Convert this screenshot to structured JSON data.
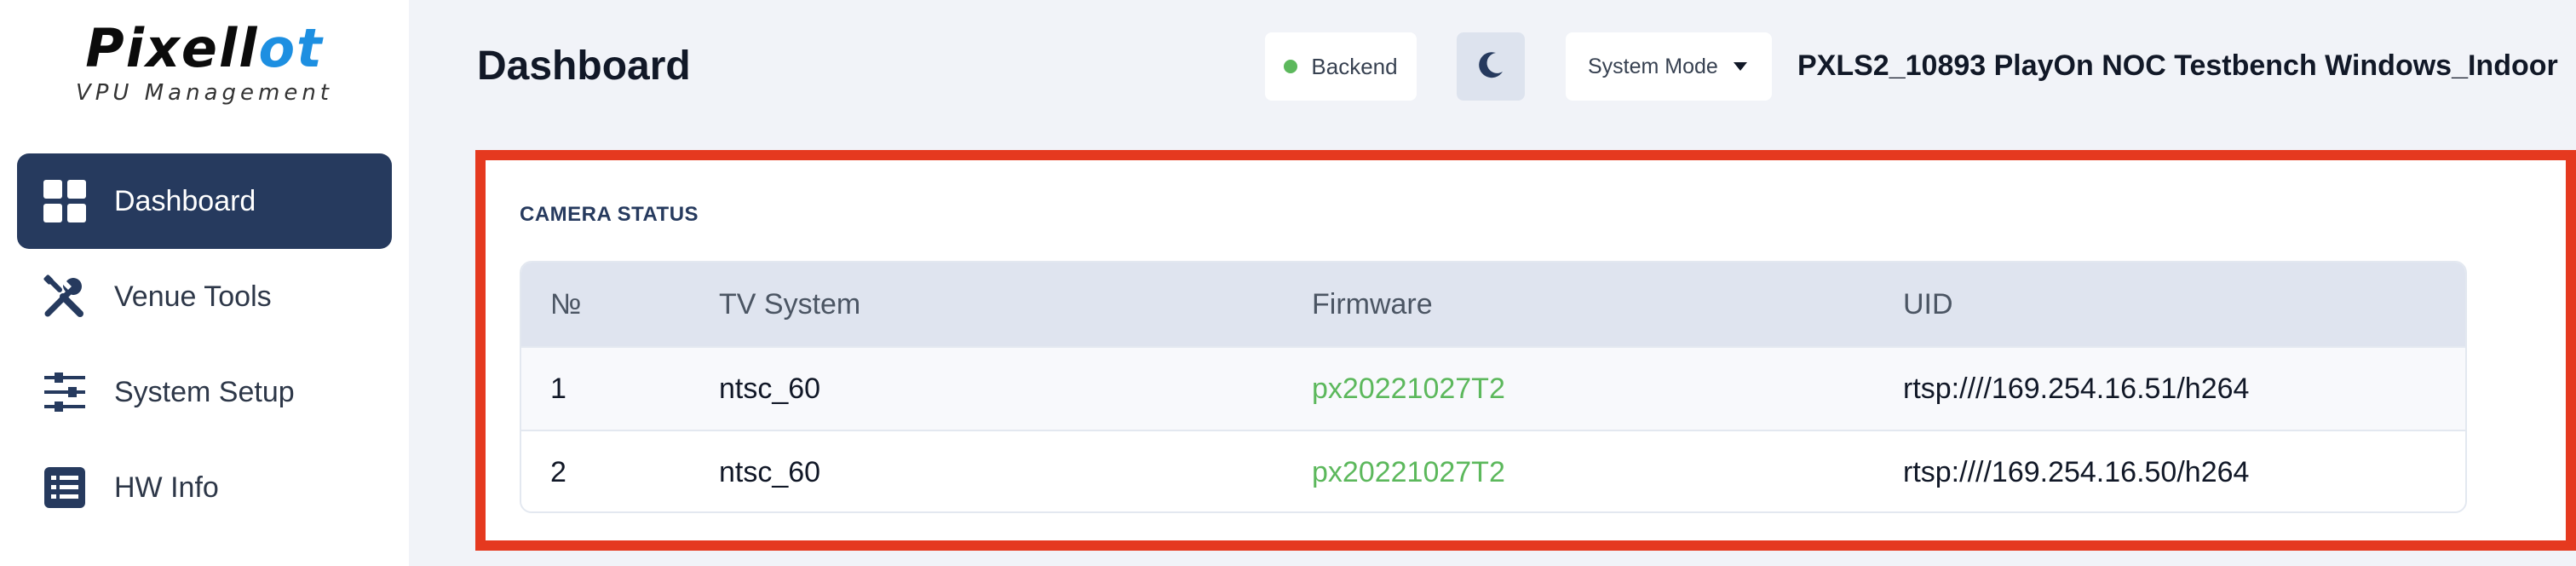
{
  "sidebar": {
    "logo_main": "Pixell",
    "logo_accent": "ot",
    "logo_sub": "VPU Management",
    "items": [
      {
        "label": "Dashboard",
        "icon": "grid-icon",
        "active": true
      },
      {
        "label": "Venue Tools",
        "icon": "tools-icon",
        "active": false
      },
      {
        "label": "System Setup",
        "icon": "sliders-icon",
        "active": false
      },
      {
        "label": "HW Info",
        "icon": "list-icon",
        "active": false
      }
    ]
  },
  "header": {
    "title": "Dashboard",
    "backend_label": "Backend",
    "backend_status_color": "#5cb85c",
    "theme_icon": "moon-icon",
    "mode_label": "System Mode",
    "device_name": "PXLS2_10893 PlayOn NOC Testbench Windows_Indoor"
  },
  "camera_status": {
    "title": "CAMERA STATUS",
    "columns": [
      "№",
      "TV System",
      "Firmware",
      "UID"
    ],
    "rows": [
      {
        "no": "1",
        "tv_system": "ntsc_60",
        "firmware": "px20221027T2",
        "uid": "rtsp:////169.254.16.51/h264"
      },
      {
        "no": "2",
        "tv_system": "ntsc_60",
        "firmware": "px20221027T2",
        "uid": "rtsp:////169.254.16.50/h264"
      }
    ]
  },
  "colors": {
    "accent": "#263a5e",
    "highlight": "#e5391f",
    "firmware": "#5cb85c"
  }
}
